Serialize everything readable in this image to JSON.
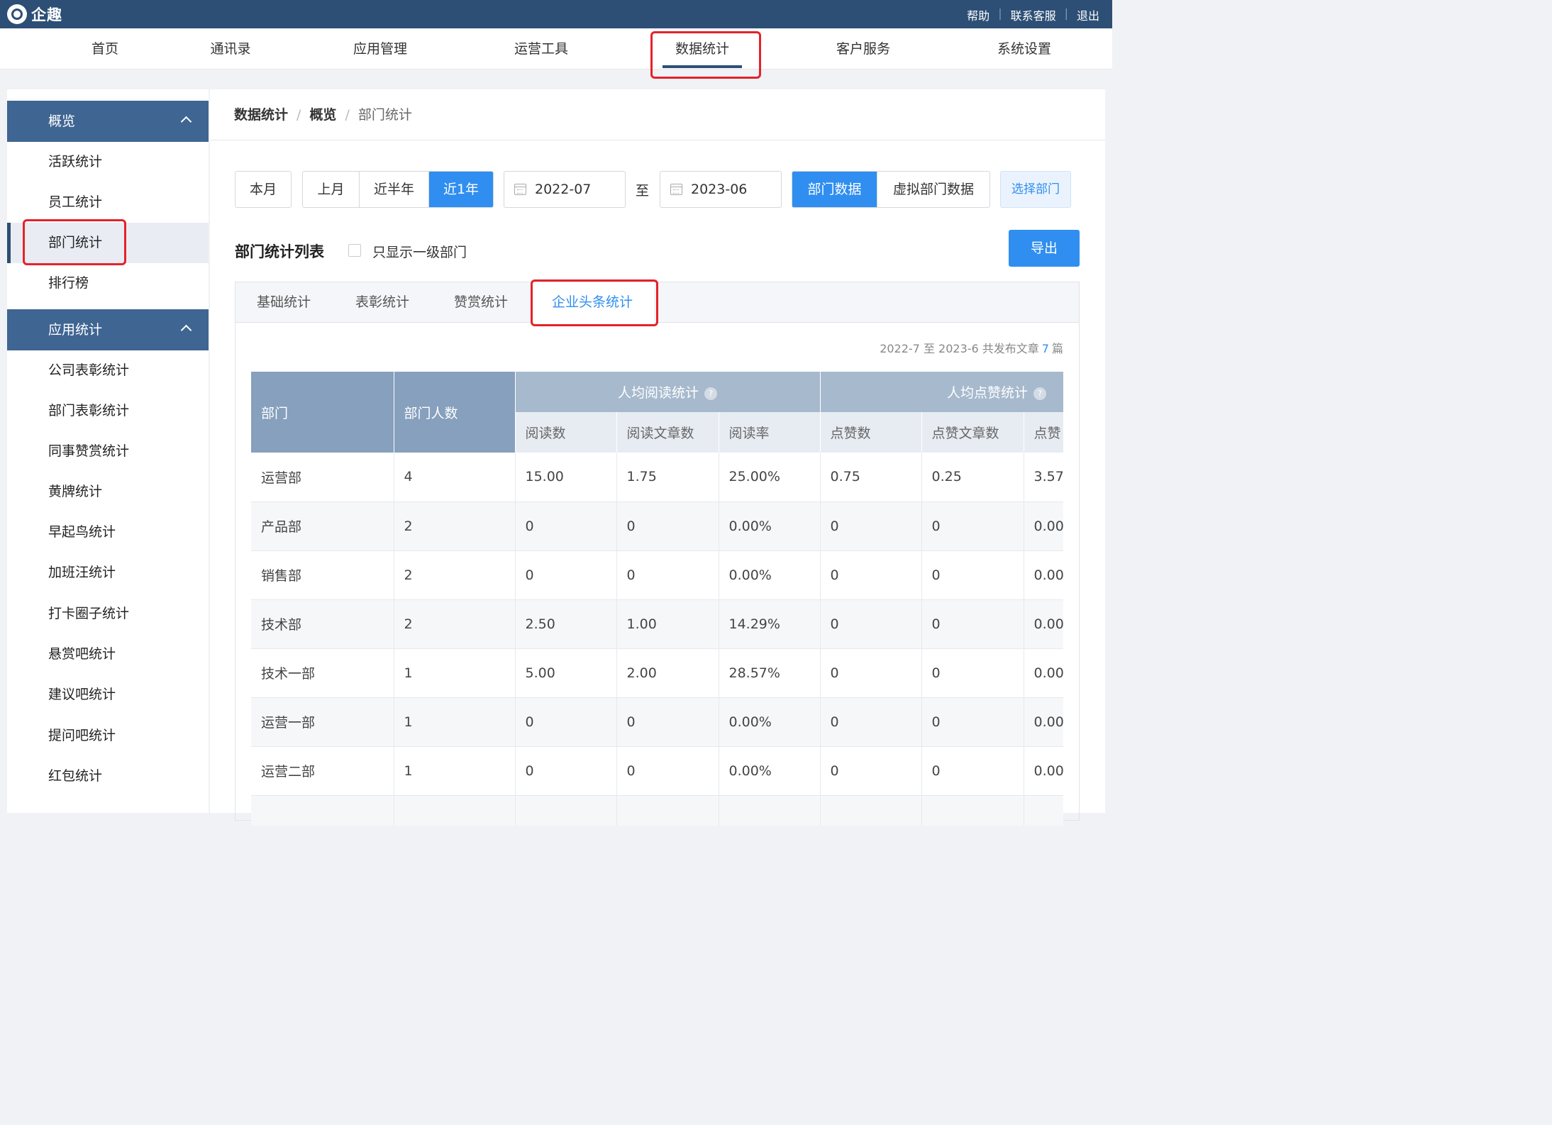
{
  "header": {
    "logo_text": "企趣",
    "links": [
      "帮助",
      "联系客服",
      "退出"
    ],
    "separator": "|"
  },
  "nav": {
    "items": [
      "首页",
      "通讯录",
      "应用管理",
      "运营工具",
      "数据统计",
      "客户服务",
      "系统设置"
    ],
    "active": "数据统计"
  },
  "sidebar": {
    "group1": "概览",
    "group1_items": [
      "活跃统计",
      "员工统计",
      "部门统计",
      "排行榜"
    ],
    "active": "部门统计",
    "group2": "应用统计",
    "group2_items": [
      "公司表彰统计",
      "部门表彰统计",
      "同事赞赏统计",
      "黄牌统计",
      "早起鸟统计",
      "加班汪统计",
      "打卡圈子统计",
      "悬赏吧统计",
      "建议吧统计",
      "提问吧统计",
      "红包统计"
    ]
  },
  "breadcrumb": {
    "items": [
      "数据统计",
      "概览",
      "部门统计"
    ],
    "separator": "/"
  },
  "filters": {
    "this_month": "本月",
    "ranges": [
      "上月",
      "近半年",
      "近1年"
    ],
    "range_selected": "近1年",
    "start": "2022-07",
    "to": "至",
    "end": "2023-06",
    "data_types": [
      "部门数据",
      "虚拟部门数据"
    ],
    "data_type_selected": "部门数据",
    "select_dept": "选择部门"
  },
  "list": {
    "title": "部门统计列表",
    "only_level1": "只显示一级部门",
    "export": "导出"
  },
  "tabs": {
    "items": [
      "基础统计",
      "表彰统计",
      "赞赏统计",
      "企业头条统计"
    ],
    "active": "企业头条统计"
  },
  "summary": {
    "prefix": "2022-7 至 2023-6 共发布文章",
    "count": "7",
    "suffix": "篇"
  },
  "table": {
    "col_dept": "部门",
    "col_count": "部门人数",
    "group_read": "人均阅读统计",
    "group_like": "人均点赞统计",
    "help_mark": "?",
    "sub_cols": [
      "阅读数",
      "阅读文章数",
      "阅读率",
      "点赞数",
      "点赞文章数",
      "点赞"
    ],
    "rows": [
      [
        "运营部",
        "4",
        "15.00",
        "1.75",
        "25.00%",
        "0.75",
        "0.25",
        "3.57"
      ],
      [
        "产品部",
        "2",
        "0",
        "0",
        "0.00%",
        "0",
        "0",
        "0.00"
      ],
      [
        "销售部",
        "2",
        "0",
        "0",
        "0.00%",
        "0",
        "0",
        "0.00"
      ],
      [
        "技术部",
        "2",
        "2.50",
        "1.00",
        "14.29%",
        "0",
        "0",
        "0.00"
      ],
      [
        "技术一部",
        "1",
        "5.00",
        "2.00",
        "28.57%",
        "0",
        "0",
        "0.00"
      ],
      [
        "运营一部",
        "1",
        "0",
        "0",
        "0.00%",
        "0",
        "0",
        "0.00"
      ],
      [
        "运营二部",
        "1",
        "0",
        "0",
        "0.00%",
        "0",
        "0",
        "0.00"
      ]
    ]
  },
  "colors": {
    "header_bg": "#2d4f75",
    "sidebar_group": "#3f6592",
    "primary": "#2f8ef0",
    "highlight": "#e5222a"
  }
}
